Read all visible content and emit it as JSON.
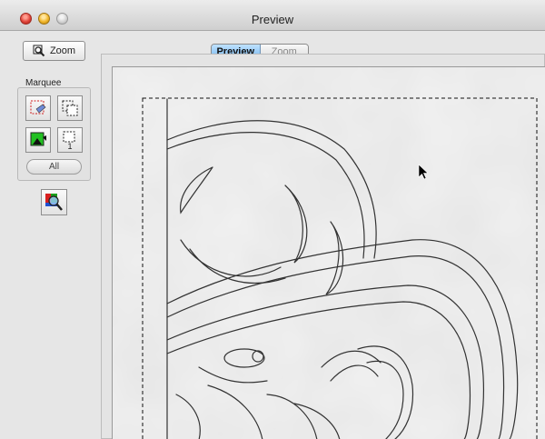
{
  "window": {
    "title": "Preview"
  },
  "sidebar": {
    "zoom_button_label": "Zoom",
    "marquee_label": "Marquee",
    "marquee_count": "1",
    "all_button_label": "All"
  },
  "tabs": [
    {
      "label": "Preview",
      "selected": true
    },
    {
      "label": "Zoom",
      "selected": false
    }
  ],
  "colors": {
    "selected_tab": "#77b8ef",
    "window_bg": "#e6e6e6"
  }
}
